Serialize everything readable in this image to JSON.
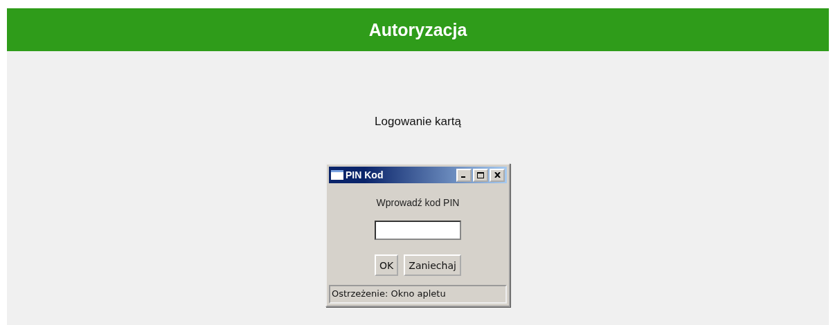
{
  "header": {
    "title": "Autoryzacja"
  },
  "content": {
    "text": "Logowanie kartą"
  },
  "dialog": {
    "title": "PIN Kod",
    "prompt": "Wprowadź kod PIN",
    "buttons": [
      "OK",
      "Zaniechaj"
    ],
    "status_bar": "Ostrzeżenie: Okno apletu"
  }
}
